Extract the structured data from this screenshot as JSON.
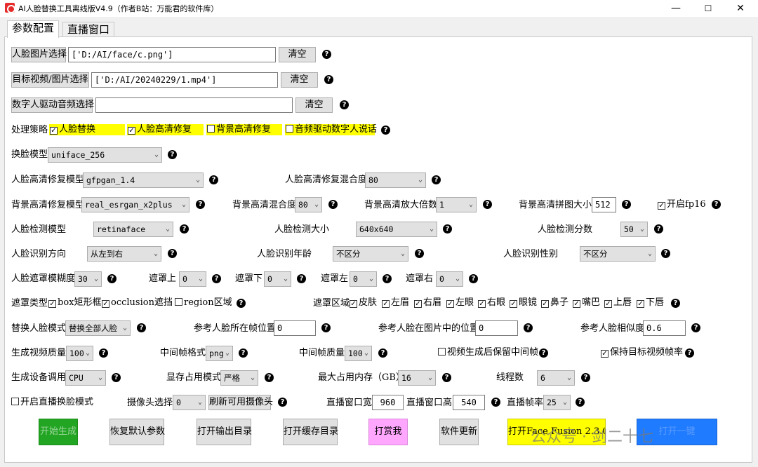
{
  "window": {
    "title": "AI人脸替换工具离线版V4.9（作者B站：万能君的软件库）",
    "min": "—",
    "max": "☐",
    "close": "✕"
  },
  "tabs": [
    "参数配置",
    "直播窗口"
  ],
  "face_img": {
    "button": "人脸图片选择",
    "value": "['D:/AI/face/c.png']",
    "clear": "清空"
  },
  "target": {
    "button": "目标视频/图片选择",
    "value": "['D:/AI/20240229/1.mp4']",
    "clear": "清空"
  },
  "audio": {
    "button": "数字人驱动音频选择",
    "value": "",
    "clear": "清空"
  },
  "strategy": {
    "label": "处理策略",
    "items": [
      {
        "label": "人脸替换",
        "checked": true
      },
      {
        "label": "人脸高清修复",
        "checked": true
      },
      {
        "label": "背景高清修复",
        "checked": false
      },
      {
        "label": "音频驱动数字人说话",
        "checked": false
      }
    ]
  },
  "swap_model": {
    "label": "换脸模型",
    "value": "uniface_256"
  },
  "enhance_model": {
    "label": "人脸高清修复模型",
    "value": "gfpgan_1.4",
    "blend_label": "人脸高清修复混合度",
    "blend_value": "80"
  },
  "bg": {
    "model_label": "背景高清修复模型",
    "model_value": "real_esrgan_x2plus",
    "blend_label": "背景高清混合度",
    "blend_value": "80",
    "scale_label": "背景高清放大倍数",
    "scale_value": "1",
    "tile_label": "背景高清拼图大小",
    "tile_value": "512",
    "fp16_label": "开启fp16",
    "fp16_checked": true
  },
  "detect": {
    "model_label": "人脸检测模型",
    "model_value": "retinaface",
    "size_label": "人脸检测大小",
    "size_value": "640x640",
    "score_label": "人脸检测分数",
    "score_value": "50"
  },
  "recog": {
    "dir_label": "人脸识别方向",
    "dir_value": "从左到右",
    "age_label": "人脸识别年龄",
    "age_value": "不区分",
    "gender_label": "人脸识别性别",
    "gender_value": "不区分"
  },
  "mask": {
    "blur_label": "人脸遮罩模糊度",
    "blur_value": "30",
    "top_label": "遮罩上",
    "top_value": "0",
    "bottom_label": "遮罩下",
    "bottom_value": "0",
    "left_label": "遮罩左",
    "left_value": "0",
    "right_label": "遮罩右",
    "right_value": "0"
  },
  "mask_type": {
    "label": "遮罩类型",
    "items": [
      {
        "label": "box矩形框",
        "checked": true
      },
      {
        "label": "occlusion遮挡",
        "checked": true
      },
      {
        "label": "region区域",
        "checked": false
      }
    ]
  },
  "mask_region": {
    "label": "遮罩区域",
    "items": [
      "皮肤",
      "左眉",
      "右眉",
      "左眼",
      "右眼",
      "眼镜",
      "鼻子",
      "嘴巴",
      "上唇",
      "下唇"
    ]
  },
  "replace": {
    "mode_label": "替换人脸模式",
    "mode_value": "替换全部人脸",
    "frame_label": "参考人脸所在帧位置",
    "frame_value": "0",
    "pos_label": "参考人脸在图片中的位置",
    "pos_value": "0",
    "sim_label": "参考人脸相似度",
    "sim_value": "0.6"
  },
  "output": {
    "quality_label": "生成视频质量",
    "quality_value": "100",
    "fmt_label": "中间帧格式",
    "fmt_value": "png",
    "fq_label": "中间帧质量",
    "fq_value": "100",
    "keep_label": "视频生成后保留中间帧",
    "keep_checked": false,
    "fps_label": "保持目标视频帧率",
    "fps_checked": true
  },
  "device": {
    "label": "生成设备调用",
    "value": "CPU",
    "vram_label": "显存占用模式",
    "vram_value": "严格",
    "mem_label": "最大占用内存（GB）",
    "mem_value": "16",
    "threads_label": "线程数",
    "threads_value": "6"
  },
  "live": {
    "mode_label": "开启直播换脸模式",
    "mode_checked": false,
    "cam_label": "摄像头选择",
    "cam_value": "0",
    "refresh": "刷新可用摄像头",
    "w_label": "直播窗口宽",
    "w_value": "960",
    "h_label": "直播窗口高",
    "h_value": "540",
    "fps_label": "直播帧率",
    "fps_value": "25"
  },
  "actions": {
    "start": "开始生成",
    "reset": "恢复默认参数",
    "open_out": "打开输出目录",
    "open_cache": "打开缓存目录",
    "tip": "打赏我",
    "update": "软件更新",
    "facefusion": "打开Face Fusion 2.3.0",
    "other": "打开一键"
  },
  "colors": {
    "start": "#22a522",
    "tip": "#ffa6ff",
    "facefusion": "#ffff00",
    "other": "#1f7bff",
    "highlight": "#ffff00"
  },
  "watermark": "公众号 · 剑二十七"
}
